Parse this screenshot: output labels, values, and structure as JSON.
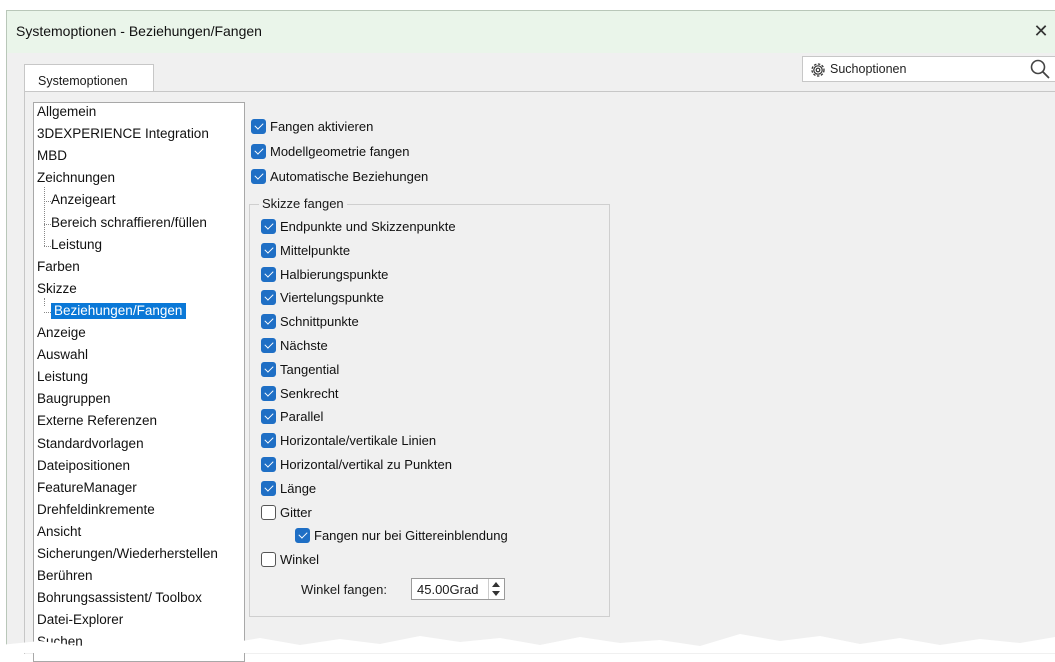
{
  "window": {
    "title": "Systemoptionen - Beziehungen/Fangen",
    "close": "✕"
  },
  "tab": {
    "label": "Systemoptionen"
  },
  "search": {
    "label": "Suchoptionen"
  },
  "tree": {
    "items": [
      "Allgemein",
      "3DEXPERIENCE Integration",
      "MBD",
      "Zeichnungen",
      "Anzeigeart",
      "Bereich schraffieren/füllen",
      "Leistung",
      "Farben",
      "Skizze",
      "Beziehungen/Fangen",
      "Anzeige",
      "Auswahl",
      "Leistung",
      "Baugruppen",
      "Externe Referenzen",
      "Standardvorlagen",
      "Dateipositionen",
      "FeatureManager",
      "Drehfeldinkremente",
      "Ansicht",
      "Sicherungen/Wiederherstellen",
      "Berühren",
      "Bohrungsassistent/ Toolbox",
      "Datei-Explorer",
      "Suchen"
    ]
  },
  "options": {
    "top": [
      {
        "label": "Fangen aktivieren",
        "checked": true
      },
      {
        "label": "Modellgeometrie fangen",
        "checked": true
      },
      {
        "label": "Automatische Beziehungen",
        "checked": true
      }
    ],
    "group_title": "Skizze fangen",
    "group": [
      {
        "label": "Endpunkte und Skizzenpunkte",
        "checked": true
      },
      {
        "label": "Mittelpunkte",
        "checked": true
      },
      {
        "label": "Halbierungspunkte",
        "checked": true
      },
      {
        "label": "Viertelungspunkte",
        "checked": true
      },
      {
        "label": "Schnittpunkte",
        "checked": true
      },
      {
        "label": "Nächste",
        "checked": true
      },
      {
        "label": "Tangential",
        "checked": true
      },
      {
        "label": "Senkrecht",
        "checked": true
      },
      {
        "label": "Parallel",
        "checked": true
      },
      {
        "label": "Horizontale/vertikale Linien",
        "checked": true
      },
      {
        "label": "Horizontal/vertikal zu Punkten",
        "checked": true
      },
      {
        "label": "Länge",
        "checked": true
      },
      {
        "label": "Gitter",
        "checked": false
      },
      {
        "label": "Fangen nur bei Gittereinblendung",
        "checked": true
      },
      {
        "label": "Winkel",
        "checked": false
      }
    ],
    "angle_label": "Winkel fangen:",
    "angle_value": "45.00Grad"
  }
}
